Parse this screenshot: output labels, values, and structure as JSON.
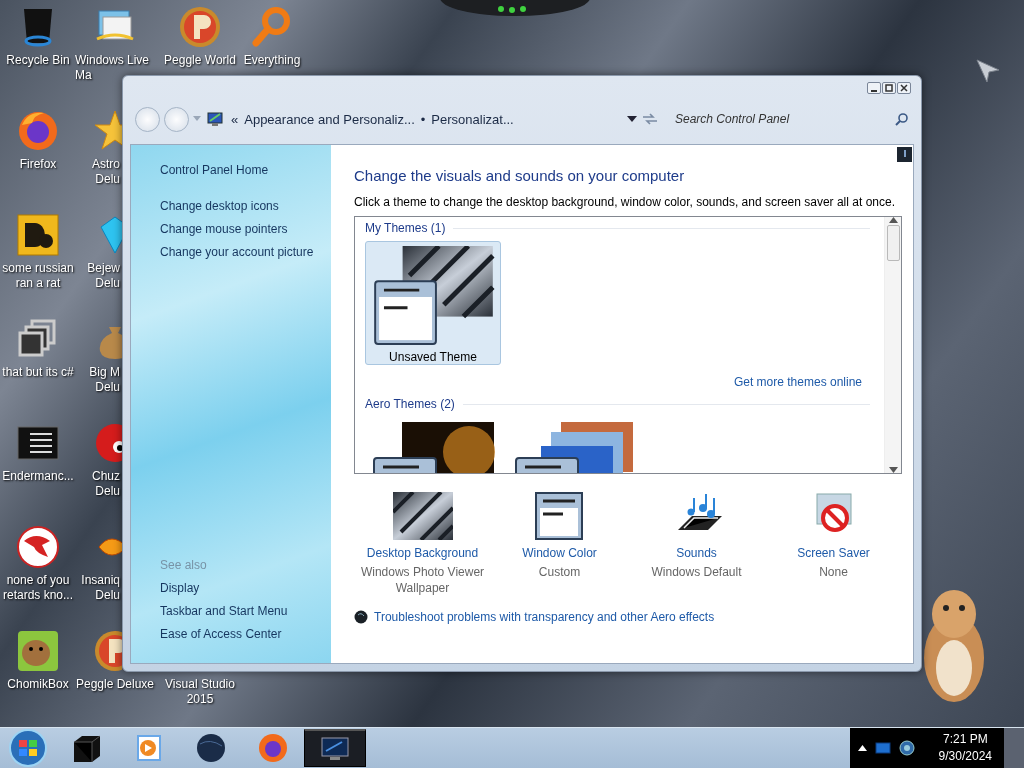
{
  "desktop": {
    "icons": [
      {
        "label": "Recycle Bin",
        "kind": "bin"
      },
      {
        "label": "Windows Live\nMa",
        "kind": "mail"
      },
      {
        "label": "Peggle World",
        "kind": "peggle"
      },
      {
        "label": "Everything",
        "kind": "magnifier"
      },
      {
        "label": "Firefox",
        "kind": "firefox"
      },
      {
        "label": "Astro\nDelu",
        "kind": "star"
      },
      {
        "label": "some russian ran a rat",
        "kind": "yellow"
      },
      {
        "label": "Bejew\nDelu",
        "kind": "gem"
      },
      {
        "label": "that but its c#",
        "kind": "stack"
      },
      {
        "label": "Big M\nDelu",
        "kind": "bag"
      },
      {
        "label": "Endermanc...",
        "kind": "console"
      },
      {
        "label": "Chuz\nDelu",
        "kind": "redball"
      },
      {
        "label": "none of you retards kno...",
        "kind": "lizard"
      },
      {
        "label": "Insaniq\nDelu",
        "kind": "fish"
      },
      {
        "label": "ChomikBox",
        "kind": "hamster"
      },
      {
        "label": "Peggle Deluxe",
        "kind": "peggle"
      },
      {
        "label": "Visual Studio 2015",
        "kind": "none"
      }
    ]
  },
  "window": {
    "breadcrumb": {
      "prefix": "«",
      "items": [
        "Appearance and Personaliz...",
        "Personalizat..."
      ],
      "separator": "•"
    },
    "search": {
      "placeholder": "Search Control Panel"
    },
    "sidebar": {
      "home": "Control Panel Home",
      "links": [
        "Change desktop icons",
        "Change mouse pointers",
        "Change your account picture"
      ],
      "see_also_title": "See also",
      "see_also": [
        "Display",
        "Taskbar and Start Menu",
        "Ease of Access Center"
      ]
    },
    "heading": "Change the visuals and sounds on your computer",
    "description": "Click a theme to change the desktop background, window color, sounds, and screen saver all at once.",
    "theme_groups": [
      {
        "title": "My Themes (1)",
        "themes": [
          {
            "label": "Unsaved Theme",
            "kind": "stripes",
            "selected": true
          }
        ],
        "link": "Get more themes online"
      },
      {
        "title": "Aero Themes (2)",
        "themes": [
          {
            "kind": "dark",
            "selected": false
          },
          {
            "kind": "landscape",
            "selected": false
          }
        ]
      }
    ],
    "settings": [
      {
        "kind": "background",
        "title": "Desktop Background",
        "value": "Windows Photo Viewer Wallpaper"
      },
      {
        "kind": "color",
        "title": "Window Color",
        "value": "Custom"
      },
      {
        "kind": "sounds",
        "title": "Sounds",
        "value": "Windows Default"
      },
      {
        "kind": "saver",
        "title": "Screen Saver",
        "value": "None"
      }
    ],
    "troubleshoot": "Troubleshoot problems with transparency and other Aero effects"
  },
  "taskbar": {
    "apps": [
      {
        "kind": "box",
        "selected": false
      },
      {
        "kind": "player",
        "selected": false
      },
      {
        "kind": "globe",
        "selected": false
      },
      {
        "kind": "firefox",
        "selected": false
      },
      {
        "kind": "monitor",
        "selected": true
      }
    ],
    "time": "7:21 PM",
    "date": "9/30/2024"
  }
}
